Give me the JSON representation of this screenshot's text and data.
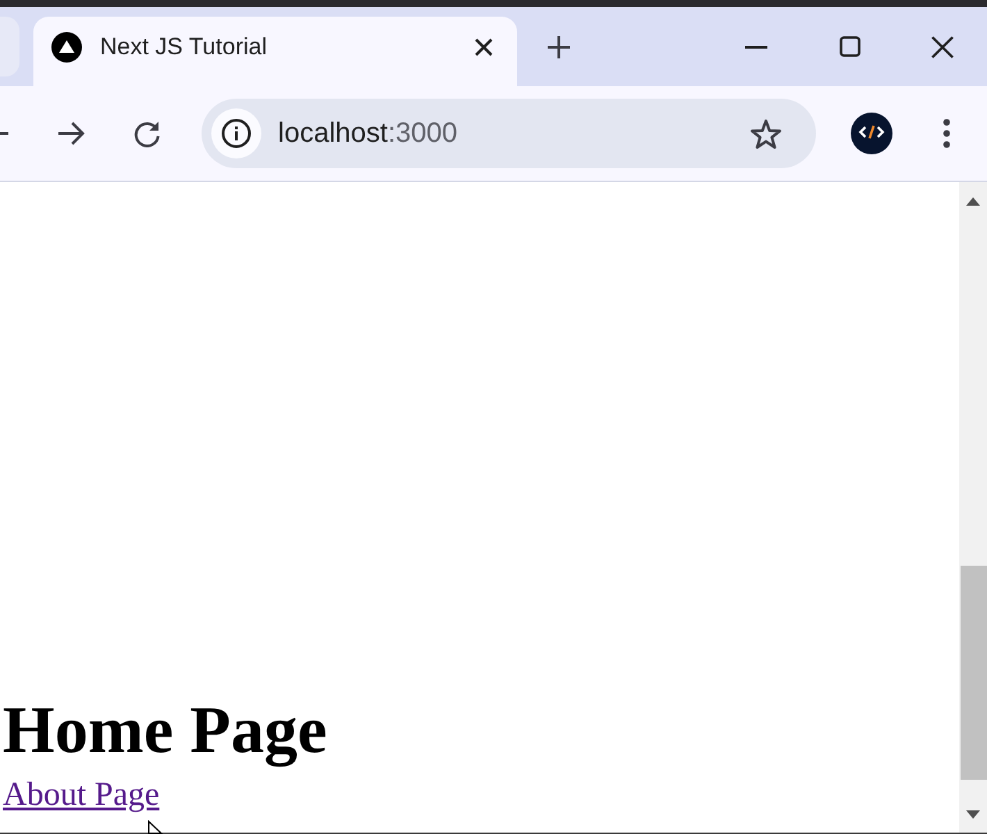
{
  "window": {
    "tabs": [
      {
        "selected": false
      },
      {
        "title": "Next JS Tutorial",
        "selected": true
      }
    ]
  },
  "toolbar": {
    "address_bar": {
      "host": "localhost",
      "port": ":3000"
    }
  },
  "page": {
    "heading": "Home Page",
    "link": {
      "label": "About Page",
      "visited": true
    }
  }
}
